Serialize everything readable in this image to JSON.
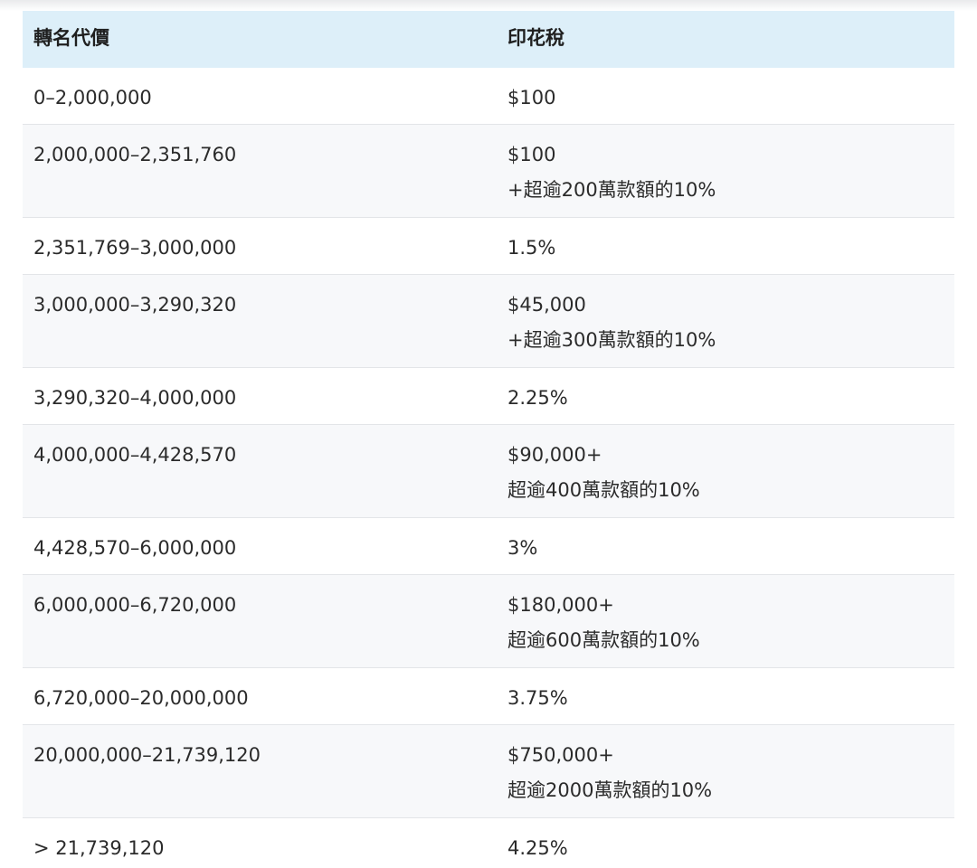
{
  "table": {
    "headers": [
      "轉名代價",
      "印花稅"
    ],
    "rows": [
      {
        "price": "0–2,000,000",
        "tax": [
          "$100"
        ]
      },
      {
        "price": "2,000,000–2,351,760",
        "tax": [
          "$100",
          "+超逾200萬款額的10%"
        ]
      },
      {
        "price": "2,351,769–3,000,000",
        "tax": [
          "1.5%"
        ]
      },
      {
        "price": "3,000,000–3,290,320",
        "tax": [
          "$45,000",
          "+超逾300萬款額的10%"
        ]
      },
      {
        "price": "3,290,320–4,000,000",
        "tax": [
          "2.25%"
        ]
      },
      {
        "price": "4,000,000–4,428,570",
        "tax": [
          "$90,000+",
          "超逾400萬款額的10%"
        ]
      },
      {
        "price": "4,428,570–6,000,000",
        "tax": [
          "3%"
        ]
      },
      {
        "price": "6,000,000–6,720,000",
        "tax": [
          "$180,000+",
          "超逾600萬款額的10%"
        ]
      },
      {
        "price": "6,720,000–20,000,000",
        "tax": [
          "3.75%"
        ]
      },
      {
        "price": "20,000,000–21,739,120",
        "tax": [
          "$750,000+",
          "超逾2000萬款額的10%"
        ]
      },
      {
        "price": "> 21,739,120",
        "tax": [
          "4.25%"
        ]
      }
    ]
  }
}
